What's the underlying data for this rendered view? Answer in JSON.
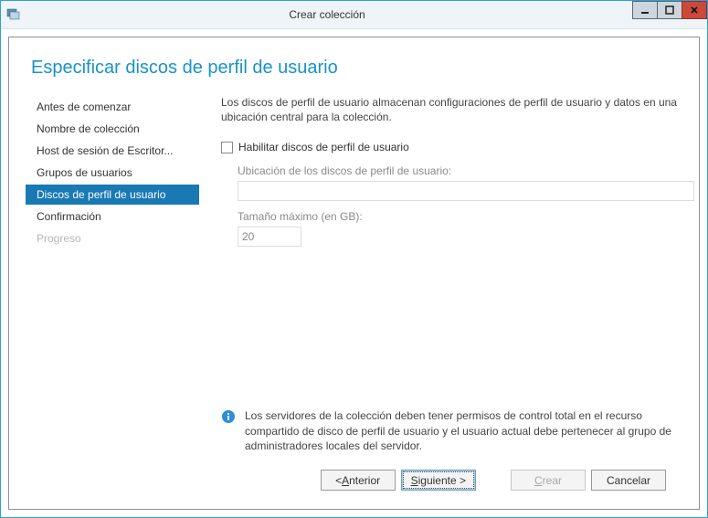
{
  "window": {
    "title": "Crear colección"
  },
  "heading": "Especificar discos de perfil de usuario",
  "steps": [
    {
      "label": "Antes de comenzar",
      "state": "normal"
    },
    {
      "label": "Nombre de colección",
      "state": "normal"
    },
    {
      "label": "Host de sesión de Escritor...",
      "state": "normal"
    },
    {
      "label": "Grupos de usuarios",
      "state": "normal"
    },
    {
      "label": "Discos de perfil de usuario",
      "state": "selected"
    },
    {
      "label": "Confirmación",
      "state": "normal"
    },
    {
      "label": "Progreso",
      "state": "disabled"
    }
  ],
  "content": {
    "description": "Los discos de perfil de usuario almacenan configuraciones de perfil de usuario y datos en una ubicación central para la colección.",
    "enable_checkbox_label": "Habilitar discos de perfil de usuario",
    "enable_checkbox_checked": false,
    "location_label": "Ubicación de los discos de perfil de usuario:",
    "location_value": "",
    "maxsize_label": "Tamaño máximo (en GB):",
    "maxsize_value": "20",
    "info_text": "Los servidores de la colección deben tener permisos de control total en el recurso compartido de disco de perfil de usuario y el usuario actual debe pertenecer al grupo de administradores locales del servidor."
  },
  "buttons": {
    "previous_prefix": "< ",
    "previous_u": "A",
    "previous_rest": "nterior",
    "next_u": "S",
    "next_rest": "iguiente >",
    "create_u": "C",
    "create_rest": "rear",
    "cancel": "Cancelar"
  }
}
